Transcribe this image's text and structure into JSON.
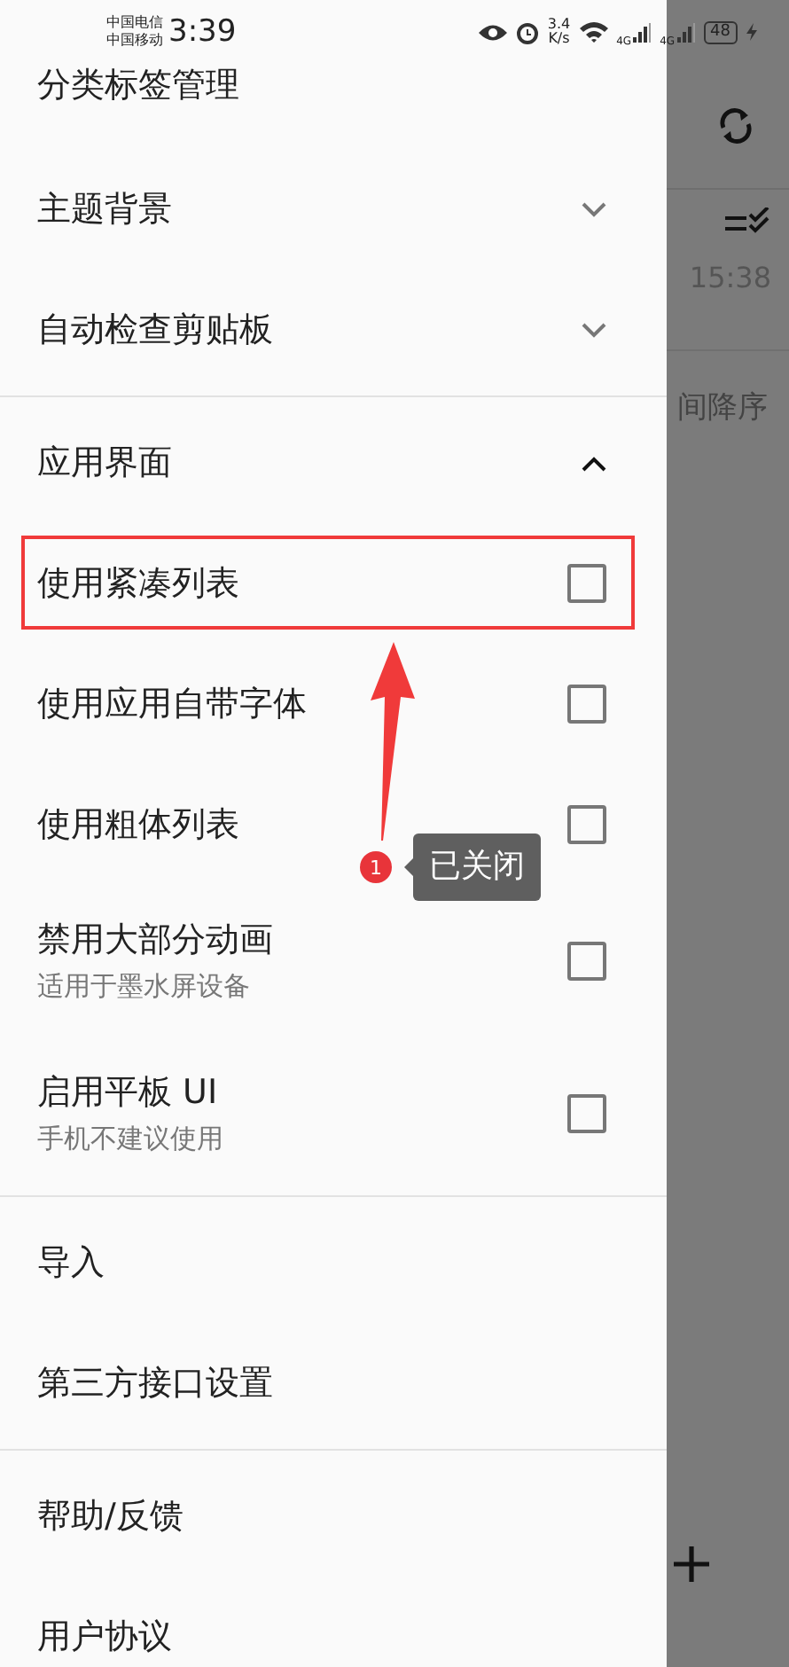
{
  "status_bar": {
    "carrier_1": "中国电信",
    "carrier_2": "中国移动",
    "time": "3:39",
    "speed_value": "3.4",
    "speed_unit": "K/s",
    "network_1": "4G",
    "network_2": "4G",
    "battery": "48"
  },
  "drawer": {
    "sections": [
      {
        "items": [
          {
            "kind": "link",
            "label": "分类标签管理"
          },
          {
            "kind": "group",
            "label": "主题背景",
            "expanded": false
          },
          {
            "kind": "group",
            "label": "自动检查剪贴板",
            "expanded": false
          }
        ]
      },
      {
        "items": [
          {
            "kind": "group",
            "label": "应用界面",
            "expanded": true
          },
          {
            "kind": "checkbox",
            "label": "使用紧凑列表",
            "checked": false,
            "highlighted": true
          },
          {
            "kind": "checkbox",
            "label": "使用应用自带字体",
            "checked": false
          },
          {
            "kind": "checkbox",
            "label": "使用粗体列表",
            "checked": false
          },
          {
            "kind": "checkbox",
            "label": "禁用大部分动画",
            "subtitle": "适用于墨水屏设备",
            "checked": false
          },
          {
            "kind": "checkbox",
            "label": "启用平板 UI",
            "subtitle": "手机不建议使用",
            "checked": false
          }
        ]
      },
      {
        "items": [
          {
            "kind": "link",
            "label": "导入"
          },
          {
            "kind": "link",
            "label": "第三方接口设置"
          }
        ]
      },
      {
        "items": [
          {
            "kind": "link",
            "label": "帮助/反馈"
          },
          {
            "kind": "link",
            "label": "用户协议"
          }
        ]
      }
    ]
  },
  "background_screen": {
    "time": "15:38",
    "sort_label": "间降序"
  },
  "annotation": {
    "badge": "1",
    "note": "已关闭"
  }
}
